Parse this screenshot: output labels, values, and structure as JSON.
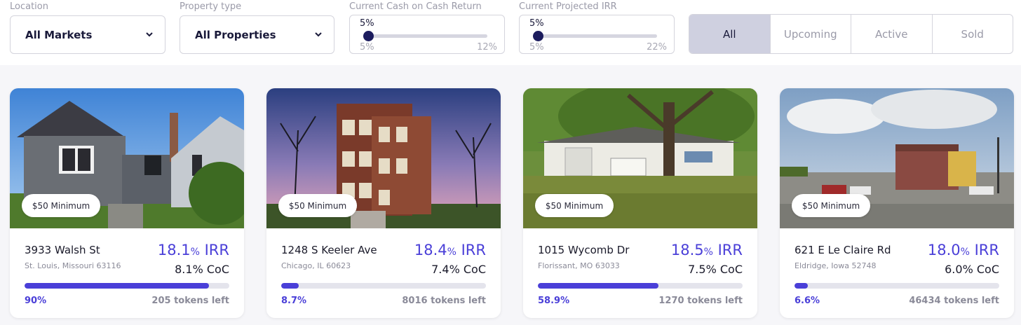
{
  "filters": {
    "location": {
      "label": "Location",
      "value": "All Markets"
    },
    "property_type": {
      "label": "Property type",
      "value": "All Properties"
    },
    "cash_on_cash": {
      "label": "Current Cash on Cash Return",
      "current": "5%",
      "min": "5%",
      "max": "12%"
    },
    "projected_irr": {
      "label": "Current Projected IRR",
      "current": "5%",
      "min": "5%",
      "max": "22%"
    },
    "status_tabs": [
      "All",
      "Upcoming",
      "Active",
      "Sold"
    ],
    "active_tab": "All"
  },
  "properties": [
    {
      "badge": "$50 Minimum",
      "address": "3933 Walsh St",
      "city": "St. Louis, Missouri 63116",
      "irr_value": "18.1",
      "irr_pct": "%",
      "irr_suffix": " IRR",
      "coc": "8.1% CoC",
      "funded_label": "90%",
      "funded_fraction": 0.9,
      "tokens": "205 tokens left"
    },
    {
      "badge": "$50 Minimum",
      "address": "1248 S Keeler Ave",
      "city": "Chicago, IL 60623",
      "irr_value": "18.4",
      "irr_pct": "%",
      "irr_suffix": " IRR",
      "coc": "7.4% CoC",
      "funded_label": "8.7%",
      "funded_fraction": 0.087,
      "tokens": "8016 tokens left"
    },
    {
      "badge": "$50 Minimum",
      "address": "1015 Wycomb Dr",
      "city": "Florissant, MO 63033",
      "irr_value": "18.5",
      "irr_pct": "%",
      "irr_suffix": " IRR",
      "coc": "7.5% CoC",
      "funded_label": "58.9%",
      "funded_fraction": 0.589,
      "tokens": "1270 tokens left"
    },
    {
      "badge": "$50 Minimum",
      "address": "621 E Le Claire Rd",
      "city": "Eldridge, Iowa 52748",
      "irr_value": "18.0",
      "irr_pct": "%",
      "irr_suffix": " IRR",
      "coc": "6.0% CoC",
      "funded_label": "6.6%",
      "funded_fraction": 0.066,
      "tokens": "46434 tokens left"
    }
  ],
  "colors": {
    "accent": "#4a3fd8",
    "slider_knob": "#1c1c5e",
    "active_tab_bg": "#cfd0e0"
  }
}
